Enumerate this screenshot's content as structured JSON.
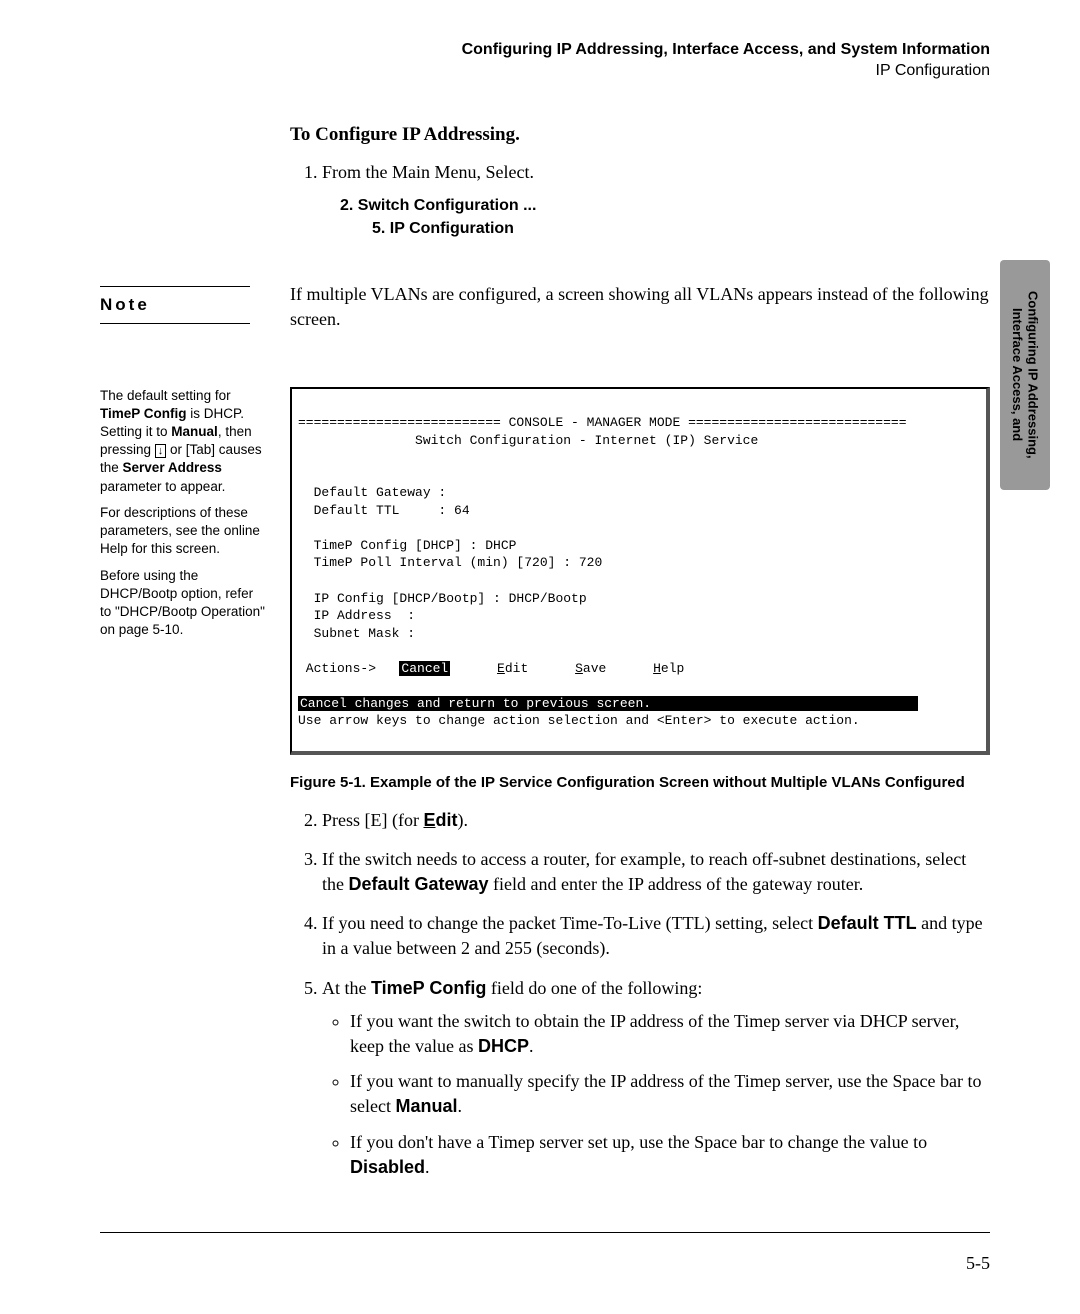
{
  "header": {
    "title": "Configuring IP Addressing, Interface Access, and System Information",
    "subtitle": "IP Configuration"
  },
  "sideTab": "Configuring IP Addressing,\nInterface Access, and",
  "section": {
    "heading": "To Configure IP Addressing.",
    "step1_intro": "From the Main Menu, Select.",
    "menu1": "2. Switch Configuration ...",
    "menu2": "5. IP Configuration"
  },
  "note": {
    "label": "Note",
    "text": "If multiple VLANs are configured, a screen showing all VLANs appears instead of the following screen."
  },
  "callout": {
    "p1a": "The default setting for ",
    "p1b": "TimeP Config",
    "p1c": " is DHCP. Setting it to ",
    "p1d": "Manual",
    "p1e": ", then pressing ",
    "p1key": "↓",
    "p1f": " or [Tab] causes the ",
    "p1g": "Server Address",
    "p1h": " parameter to appear.",
    "p2": "For descriptions of these parameters, see the online Help for this screen.",
    "p3": "Before using the DHCP/Bootp option, refer to \"DHCP/Bootp Operation\" on page 5-10."
  },
  "terminal": {
    "l1": "========================== CONSOLE - MANAGER MODE ============================",
    "l2": "               Switch Configuration - Internet (IP) Service",
    "l3": "",
    "l4": "",
    "l5": "  Default Gateway :",
    "l6": "  Default TTL     : 64",
    "l7": "",
    "l8": "  TimeP Config [DHCP] : DHCP",
    "l9": "  TimeP Poll Interval (min) [720] : 720",
    "l10": "",
    "l11": "  IP Config [DHCP/Bootp] : DHCP/Bootp",
    "l12": "  IP Address  :",
    "l13": "  Subnet Mask :",
    "l14": "",
    "actions_label": " Actions->   ",
    "cancel": "Cancel",
    "gap1": "      ",
    "edit_u": "E",
    "edit_r": "dit",
    "gap2": "      ",
    "save_u": "S",
    "save_r": "ave",
    "gap3": "      ",
    "help_u": "H",
    "help_r": "elp",
    "status1": "Cancel changes and return to previous screen.",
    "status1_pad": "                                  ",
    "status2": "Use arrow keys to change action selection and <Enter> to execute action."
  },
  "figureCaption": "Figure 5-1.  Example of the IP Service Configuration Screen without Multiple VLANs Configured",
  "steps": {
    "s2a": "Press [E] (for ",
    "s2b": "E",
    "s2c": "dit",
    "s2d": ").",
    "s3a": "If the switch needs to access a router, for example, to reach off-subnet destinations, select the ",
    "s3b": "Default Gateway",
    "s3c": "  field and enter the IP address of the gateway router.",
    "s4a": "If you need to change the packet Time-To-Live (TTL) setting, select ",
    "s4b": "Default TTL",
    "s4c": " and type in a value between 2 and 255 (seconds).",
    "s5a": "At the  ",
    "s5b": "TimeP Config",
    "s5c": "  field do one of the following:",
    "b1a": "If you want the switch to obtain the IP address of the Timep server via DHCP server, keep the value as  ",
    "b1b": "DHCP",
    "b1c": ".",
    "b2a": "If you want to manually specify the IP address of the Timep server, use the Space bar to select  ",
    "b2b": "Manual",
    "b2c": ".",
    "b3a": "If you don't have a Timep server set up, use the Space bar to change the value to  ",
    "b3b": "Disabled",
    "b3c": "."
  },
  "pageNumber": "5-5"
}
